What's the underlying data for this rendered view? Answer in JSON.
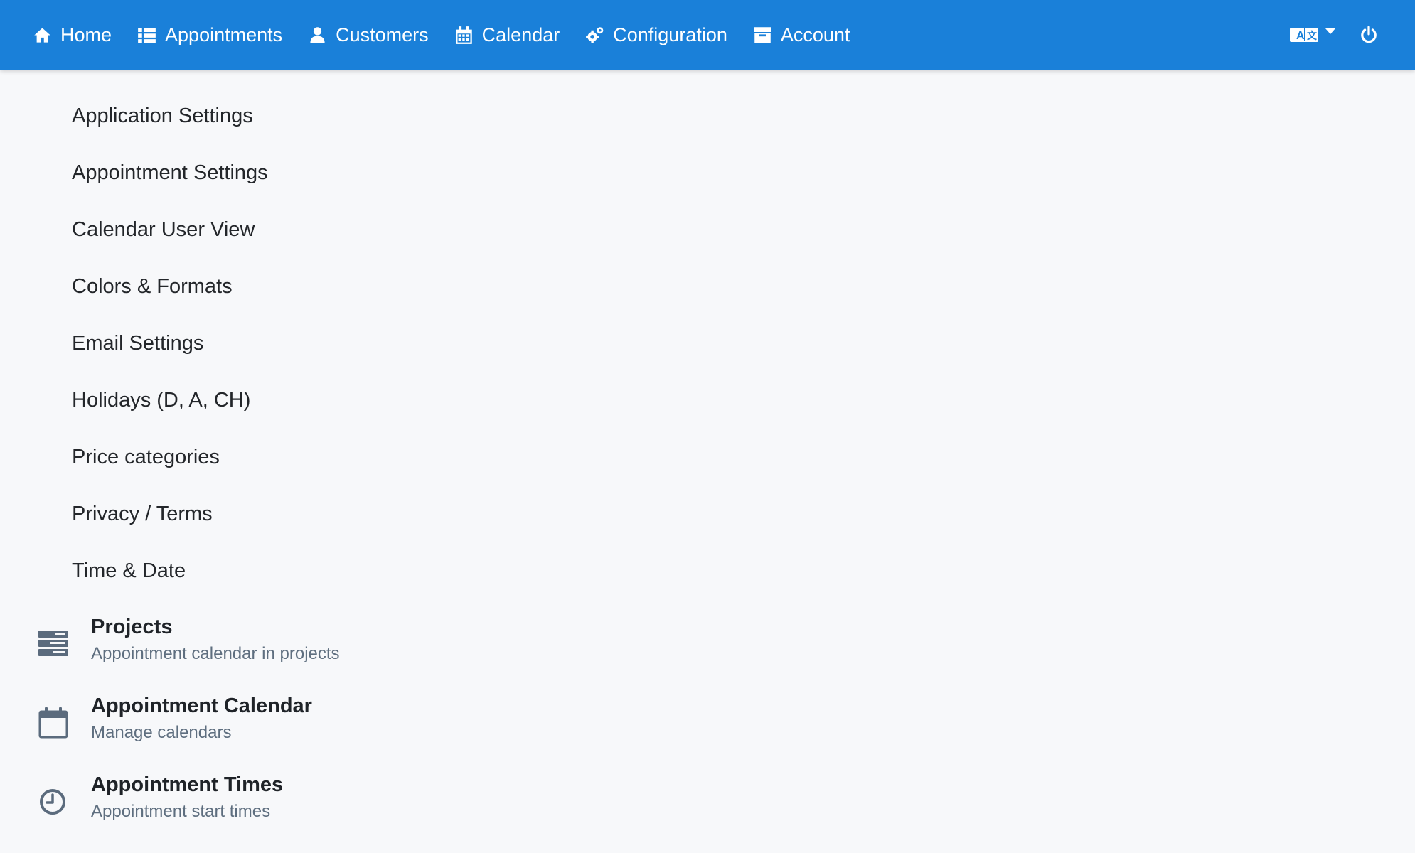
{
  "nav": {
    "items": [
      {
        "label": "Home",
        "icon": "home-icon"
      },
      {
        "label": "Appointments",
        "icon": "list-icon"
      },
      {
        "label": "Customers",
        "icon": "user-icon"
      },
      {
        "label": "Calendar",
        "icon": "calendar-icon"
      },
      {
        "label": "Configuration",
        "icon": "cogs-icon"
      },
      {
        "label": "Account",
        "icon": "archive-icon"
      }
    ],
    "language_icon": "language-icon",
    "power_icon": "power-icon"
  },
  "submenu": {
    "items": [
      "Application Settings",
      "Appointment Settings",
      "Calendar User View",
      "Colors & Formats",
      "Email Settings",
      "Holidays (D, A, CH)",
      "Price categories",
      "Privacy / Terms",
      "Time & Date"
    ]
  },
  "sections": [
    {
      "title": "Projects",
      "subtitle": "Appointment calendar in projects",
      "icon": "server-stack-icon"
    },
    {
      "title": "Appointment Calendar",
      "subtitle": "Manage calendars",
      "icon": "calendar-outline-icon"
    },
    {
      "title": "Appointment Times",
      "subtitle": "Appointment start times",
      "icon": "clock-icon"
    }
  ],
  "colors": {
    "navbar": "#1a80d9",
    "background": "#f7f8fa",
    "icon_gray": "#5b6b7d"
  }
}
